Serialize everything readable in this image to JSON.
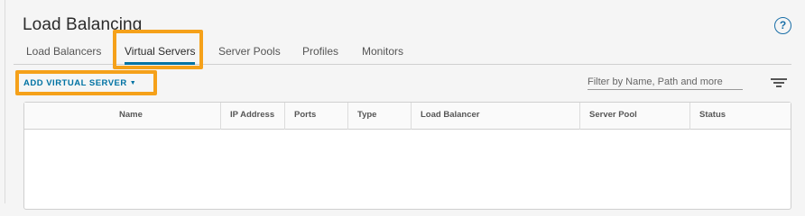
{
  "page": {
    "title": "Load Balancing",
    "help_glyph": "?"
  },
  "tabs": [
    {
      "label": "Load Balancers",
      "active": false
    },
    {
      "label": "Virtual Servers",
      "active": true
    },
    {
      "label": "Server Pools",
      "active": false
    },
    {
      "label": "Profiles",
      "active": false
    },
    {
      "label": "Monitors",
      "active": false
    }
  ],
  "toolbar": {
    "add_label": "ADD VIRTUAL SERVER",
    "filter_placeholder": "Filter by Name, Path and more"
  },
  "grid": {
    "columns": [
      "Name",
      "IP Address",
      "Ports",
      "Type",
      "Load Balancer",
      "Server Pool",
      "Status"
    ],
    "rows": []
  },
  "colors": {
    "accent": "#0072a3",
    "highlight": "#f5a11a",
    "background": "#f5f5f5"
  },
  "icons": {
    "help": "help-circle-icon",
    "filter": "filter-lines-icon",
    "dropdown": "chevron-down-icon"
  }
}
